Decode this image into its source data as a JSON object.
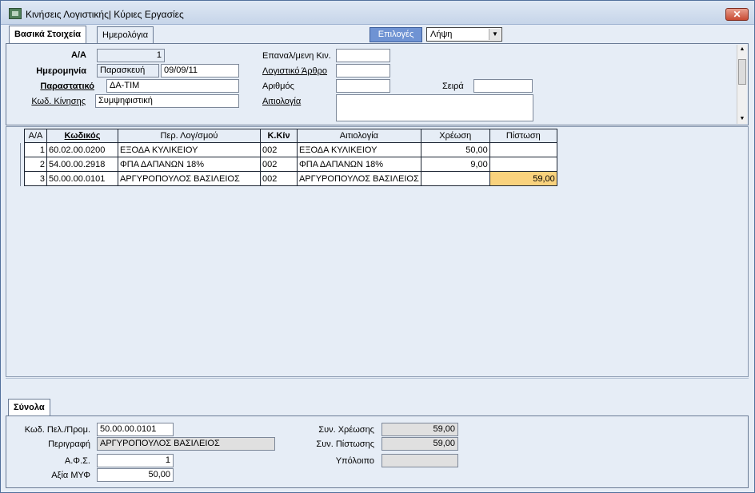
{
  "window": {
    "title": "Κινήσεις Λογιστικής| Κύριες Εργασίες",
    "close_label": "✕"
  },
  "tabs": {
    "main": "Βασικά Στοιχεία",
    "journals": "Ημερολόγια"
  },
  "toolbar": {
    "options_label": "Επιλογές",
    "select_value": "Λήψη"
  },
  "header": {
    "aa_label": "Α/Α",
    "aa_value": "1",
    "date_label": "Ημερομηνία",
    "day_value": "Παρασκευή",
    "date_value": "09/09/11",
    "doc_label": "Παραστατικό",
    "doc_value": "ΔΑ-ΤΙΜ",
    "move_code_label": "Κωδ. Κίνησης",
    "move_code_value": "Συμψηφιστική",
    "recurring_label": "Επαναλ/μενη Κιν.",
    "recurring_value": "",
    "article_label": "Λογιστικό Άρθρο",
    "article_value": "",
    "number_label": "Αριθμός",
    "number_value": "",
    "series_label": "Σειρά",
    "series_value": "",
    "reason_label": "Αιτιολογία",
    "reason_value": ""
  },
  "grid": {
    "columns": [
      "Α/Α",
      "Κωδικός",
      "Περ. Λογ/σμού",
      "Κ.Κίν",
      "Αιτιολογία",
      "Χρέωση",
      "Πίστωση"
    ],
    "rows": [
      {
        "aa": "1",
        "code": "60.02.00.0200",
        "desc": "ΕΞΟΔΑ ΚΥΛΙΚΕΙΟΥ",
        "kkin": "002",
        "reason": "ΕΞΟΔΑ ΚΥΛΙΚΕΙΟΥ",
        "debit": "50,00",
        "credit": ""
      },
      {
        "aa": "2",
        "code": "54.00.00.2918",
        "desc": "ΦΠΑ ΔΑΠΑΝΩΝ 18%",
        "kkin": "002",
        "reason": "ΦΠΑ ΔΑΠΑΝΩΝ 18%",
        "debit": "9,00",
        "credit": ""
      },
      {
        "aa": "3",
        "code": "50.00.00.0101",
        "desc": "ΑΡΓΥΡΟΠΟΥΛΟΣ ΒΑΣΙΛΕΙΟΣ",
        "kkin": "002",
        "reason": "ΑΡΓΥΡΟΠΟΥΛΟΣ ΒΑΣΙΛΕΙΟΣ",
        "debit": "",
        "credit": "59,00"
      }
    ]
  },
  "totals": {
    "tab_label": "Σύνολα",
    "customer_code_label": "Κωδ. Πελ./Προμ.",
    "customer_code_value": "50.00.00.0101",
    "description_label": "Περιγραφή",
    "description_value": "ΑΡΓΥΡΟΠΟΥΛΟΣ ΒΑΣΙΛΕΙΟΣ",
    "afs_label": "Α.Φ.Σ.",
    "afs_value": "1",
    "myf_label": "Αξία ΜΥΦ",
    "myf_value": "50,00",
    "debit_total_label": "Συν. Χρέωσης",
    "debit_total_value": "59,00",
    "credit_total_label": "Συν. Πίστωσης",
    "credit_total_value": "59,00",
    "balance_label": "Υπόλοιπο",
    "balance_value": ""
  },
  "colors": {
    "highlight": "#f9d27d",
    "options_button": "#6f93d3",
    "close_button": "#c84a32"
  }
}
